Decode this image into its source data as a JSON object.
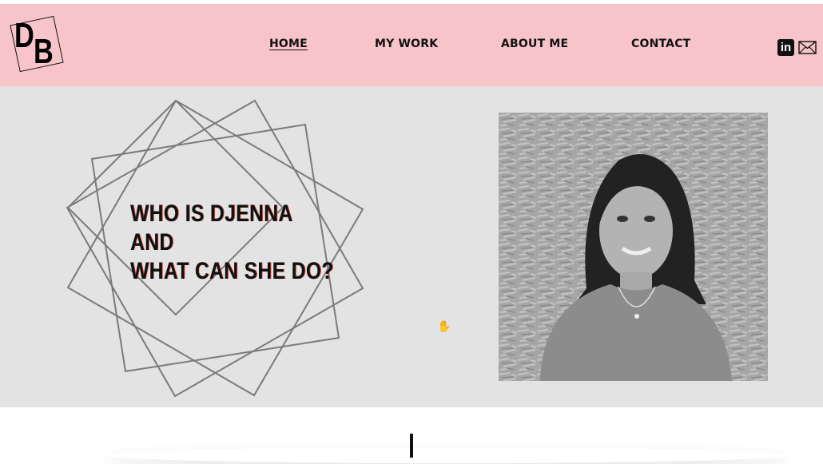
{
  "header": {
    "logo_text": {
      "first": "D",
      "second": "B"
    },
    "background": "#f7c5c9"
  },
  "nav": {
    "items": [
      {
        "label": "HOME",
        "active": true
      },
      {
        "label": "MY WORK",
        "active": false
      },
      {
        "label": "ABOUT ME",
        "active": false
      },
      {
        "label": "CONTACT",
        "active": false
      }
    ]
  },
  "social": {
    "linkedin": {
      "icon": "linkedin-icon",
      "glyph": "in"
    },
    "email": {
      "icon": "mail-icon"
    }
  },
  "hero": {
    "headline": [
      "WHO IS DJENNA",
      "AND",
      "WHAT CAN SHE DO?"
    ],
    "background": "#e3e3e3",
    "photo": {
      "icon": "portrait-photo",
      "style": "black-and-white"
    }
  },
  "colors": {
    "text": "#111111",
    "shape_stroke": "#7a7a7a"
  }
}
